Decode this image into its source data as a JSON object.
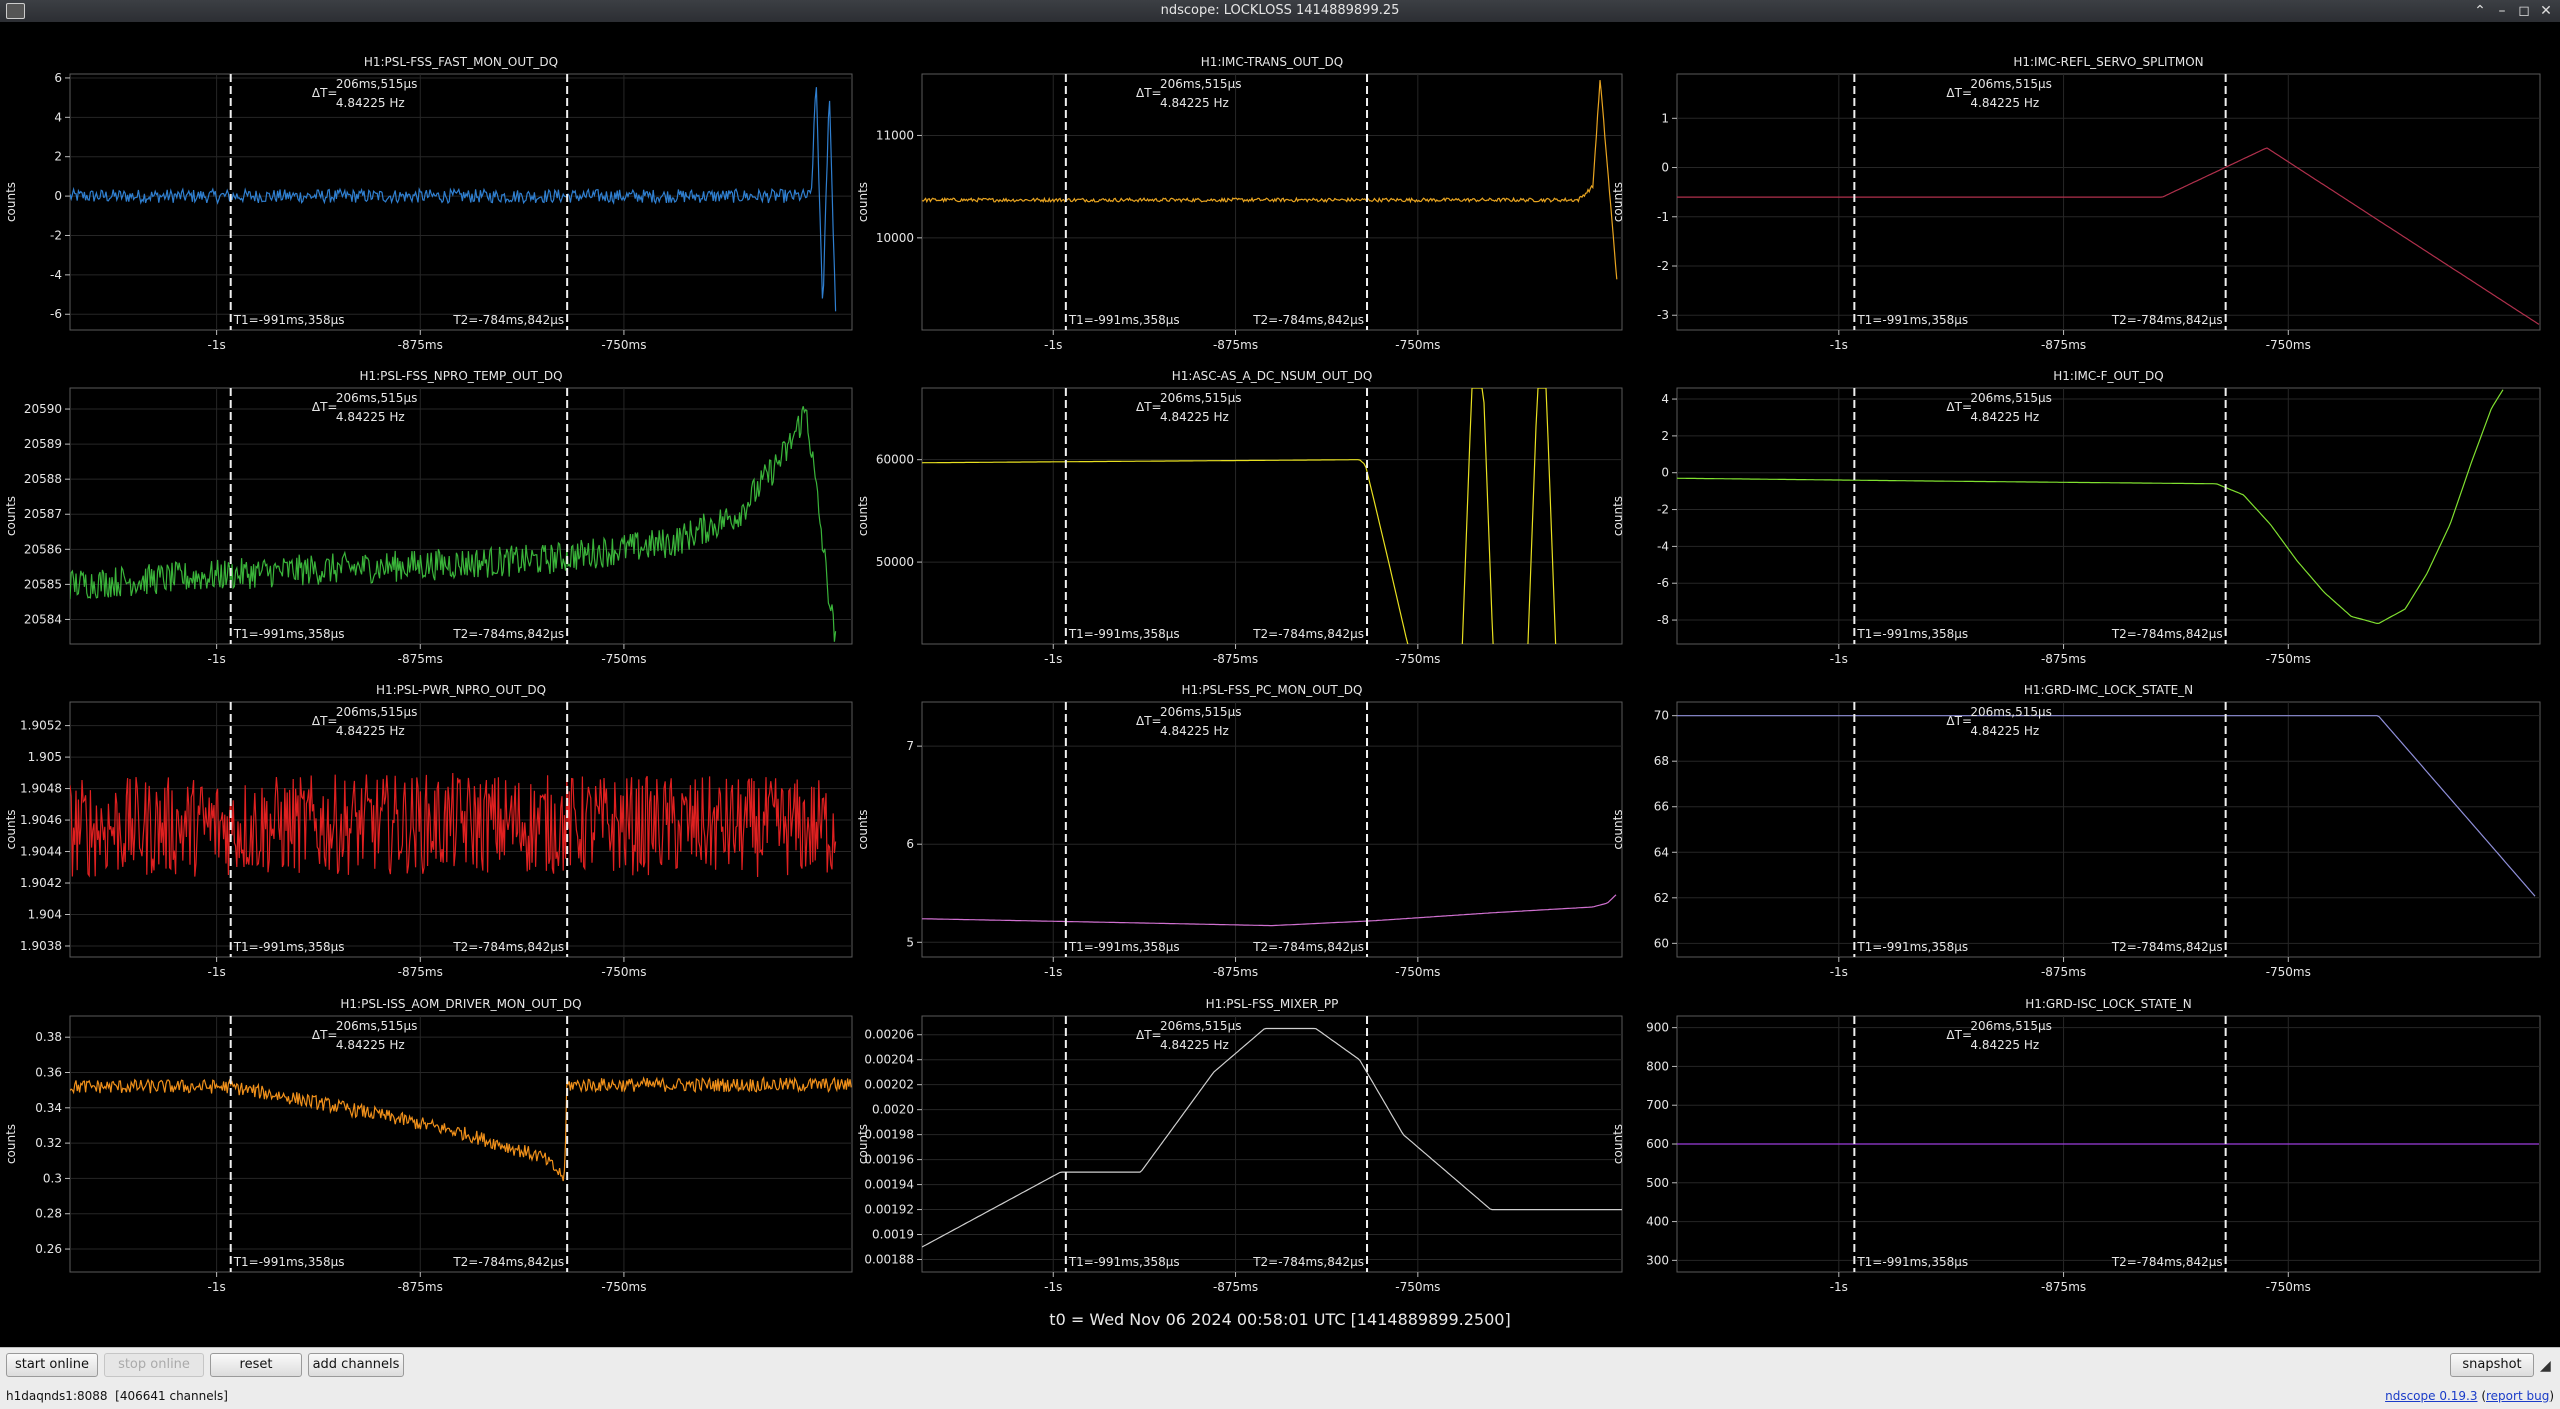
{
  "window": {
    "title": "ndscope: LOCKLOSS 1414889899.25",
    "controls": {
      "shade": "⌃",
      "minimize": "–",
      "maximize": "◻",
      "close": "✕"
    }
  },
  "cursor": {
    "delta_t": "ΔT=",
    "delta_value": "206ms,515μs",
    "freq": "4.84225 Hz",
    "t1_label": "T1=-991ms,358μs",
    "t2_label": "T2=-784ms,842μs",
    "t1_value": -0.991358,
    "t2_value": -0.784842
  },
  "x_axis": {
    "range": [
      -1.09,
      -0.61
    ],
    "ticks": [
      {
        "v": -1.0,
        "label": "-1s"
      },
      {
        "v": -0.875,
        "label": "-875ms"
      },
      {
        "v": -0.75,
        "label": "-750ms"
      }
    ]
  },
  "t0_label": "t0 = Wed Nov 06 2024 00:58:01 UTC [1414889899.2500]",
  "toolbar": {
    "start_online": "start online",
    "stop_online": "stop online",
    "reset": "reset",
    "add_channels": "add channels",
    "snapshot": "snapshot"
  },
  "status": {
    "server": "h1daqnds1:8088",
    "channels": "[406641 channels]",
    "version_link": "ndscope 0.19.3",
    "report_link": "report bug"
  },
  "chart_data": [
    {
      "type": "line",
      "title": "H1:PSL-FSS_FAST_MON_OUT_DQ",
      "ylabel": "counts",
      "color": "#2f7fd0",
      "ylim": [
        -6.8,
        6.2
      ],
      "yticks": [
        {
          "v": 6,
          "label": "6"
        },
        {
          "v": 4,
          "label": "4"
        },
        {
          "v": 2,
          "label": "2"
        },
        {
          "v": 0,
          "label": "0"
        },
        {
          "v": -2,
          "label": "-2"
        },
        {
          "v": -4,
          "label": "-4"
        },
        {
          "v": -6,
          "label": "-6"
        }
      ],
      "x": [
        -1.09,
        -0.95,
        -0.8,
        -0.7,
        -0.635,
        -0.632,
        -0.628,
        -0.624,
        -0.62
      ],
      "y": [
        0.0,
        0.0,
        0.0,
        0.0,
        0.0,
        6.0,
        -6.0,
        5.5,
        -6.0
      ],
      "noise": 0.35
    },
    {
      "type": "line",
      "title": "H1:IMC-TRANS_OUT_DQ",
      "ylabel": "counts",
      "color": "#e8a420",
      "ylim": [
        9100,
        11600
      ],
      "yticks": [
        {
          "v": 11000,
          "label": "11000"
        },
        {
          "v": 10000,
          "label": "10000"
        }
      ],
      "x": [
        -1.09,
        -0.8,
        -0.64,
        -0.63,
        -0.625,
        -0.613
      ],
      "y": [
        10370,
        10370,
        10370,
        10500,
        11550,
        9500
      ],
      "noise": 18
    },
    {
      "type": "line",
      "title": "H1:IMC-REFL_SERVO_SPLITMON",
      "ylabel": "counts",
      "color": "#b0304c",
      "ylim": [
        -3.3,
        1.9
      ],
      "yticks": [
        {
          "v": 1,
          "label": "1"
        },
        {
          "v": 0,
          "label": "0"
        },
        {
          "v": -1,
          "label": "-1"
        },
        {
          "v": -2,
          "label": "-2"
        },
        {
          "v": -3,
          "label": "-3"
        }
      ],
      "x": [
        -1.09,
        -0.82,
        -0.762,
        -0.61
      ],
      "y": [
        -0.6,
        -0.6,
        0.4,
        -3.2
      ],
      "noise": 0
    },
    {
      "type": "line",
      "title": "H1:PSL-FSS_NPRO_TEMP_OUT_DQ",
      "ylabel": "counts",
      "color": "#3ab43a",
      "ylim": [
        20583.3,
        20590.6
      ],
      "yticks": [
        {
          "v": 20590,
          "label": "20590"
        },
        {
          "v": 20589,
          "label": "20589"
        },
        {
          "v": 20588,
          "label": "20588"
        },
        {
          "v": 20587,
          "label": "20587"
        },
        {
          "v": 20586,
          "label": "20586"
        },
        {
          "v": 20585,
          "label": "20585"
        },
        {
          "v": 20584,
          "label": "20584"
        }
      ],
      "x": [
        -1.09,
        -0.95,
        -0.8,
        -0.72,
        -0.68,
        -0.65,
        -0.638,
        -0.625,
        -0.62
      ],
      "y": [
        20585.0,
        20585.4,
        20585.7,
        20586.2,
        20587.0,
        20588.8,
        20590.0,
        20585.0,
        20583.3
      ],
      "noise": 0.45
    },
    {
      "type": "line",
      "title": "H1:ASC-AS_A_DC_NSUM_OUT_DQ",
      "ylabel": "counts",
      "color": "#e8e020",
      "ylim": [
        42000,
        67000
      ],
      "yticks": [
        {
          "v": 60000,
          "label": "60000"
        },
        {
          "v": 50000,
          "label": "50000"
        }
      ],
      "x": [
        -1.09,
        -0.79,
        -0.786,
        -0.78,
        -0.77,
        -0.757,
        -0.75,
        -0.72,
        -0.713,
        -0.705,
        -0.698,
        -0.675,
        -0.668,
        -0.662,
        -0.655
      ],
      "y": [
        59700,
        60000,
        59500,
        56000,
        50000,
        42000,
        40000,
        40000,
        67000,
        67000,
        40000,
        40000,
        67000,
        67000,
        40000
      ],
      "noise": 0
    },
    {
      "type": "line",
      "title": "H1:IMC-F_OUT_DQ",
      "ylabel": "counts",
      "color": "#80e030",
      "ylim": [
        -9.3,
        4.6
      ],
      "yticks": [
        {
          "v": 4,
          "label": "4"
        },
        {
          "v": 2,
          "label": "2"
        },
        {
          "v": 0,
          "label": "0"
        },
        {
          "v": -2,
          "label": "-2"
        },
        {
          "v": -4,
          "label": "-4"
        },
        {
          "v": -6,
          "label": "-6"
        },
        {
          "v": -8,
          "label": "-8"
        }
      ],
      "x": [
        -1.09,
        -0.95,
        -0.79,
        -0.775,
        -0.76,
        -0.745,
        -0.73,
        -0.715,
        -0.7,
        -0.685,
        -0.673,
        -0.66,
        -0.648,
        -0.637,
        -0.63
      ],
      "y": [
        -0.3,
        -0.45,
        -0.6,
        -1.2,
        -2.8,
        -4.8,
        -6.5,
        -7.8,
        -8.2,
        -7.4,
        -5.5,
        -2.8,
        0.6,
        3.5,
        4.6
      ],
      "noise": 0
    },
    {
      "type": "line",
      "title": "H1:PSL-PWR_NPRO_OUT_DQ",
      "ylabel": "counts",
      "color": "#e02020",
      "ylim": [
        1.90373,
        1.90535
      ],
      "yticks": [
        {
          "v": 1.9052,
          "label": "1.9052"
        },
        {
          "v": 1.905,
          "label": "1.905"
        },
        {
          "v": 1.9048,
          "label": "1.9048"
        },
        {
          "v": 1.9046,
          "label": "1.9046"
        },
        {
          "v": 1.9044,
          "label": "1.9044"
        },
        {
          "v": 1.9042,
          "label": "1.9042"
        },
        {
          "v": 1.904,
          "label": "1.904"
        },
        {
          "v": 1.9038,
          "label": "1.9038"
        }
      ],
      "x": [
        -1.09,
        -0.85,
        -0.62
      ],
      "y": [
        1.90455,
        1.90458,
        1.90455
      ],
      "noise": 0.00032
    },
    {
      "type": "line",
      "title": "H1:PSL-FSS_PC_MON_OUT_DQ",
      "ylabel": "counts",
      "color": "#d070d0",
      "ylim": [
        4.85,
        7.45
      ],
      "yticks": [
        {
          "v": 7,
          "label": "7"
        },
        {
          "v": 6,
          "label": "6"
        },
        {
          "v": 5,
          "label": "5"
        }
      ],
      "x": [
        -1.09,
        -0.95,
        -0.85,
        -0.78,
        -0.7,
        -0.63,
        -0.62,
        -0.613
      ],
      "y": [
        5.24,
        5.2,
        5.17,
        5.22,
        5.3,
        5.36,
        5.4,
        5.5
      ],
      "noise": 0
    },
    {
      "type": "line",
      "title": "H1:GRD-IMC_LOCK_STATE_N",
      "ylabel": "counts",
      "color": "#8e8ed8",
      "ylim": [
        59.4,
        70.6
      ],
      "yticks": [
        {
          "v": 70,
          "label": "70"
        },
        {
          "v": 68,
          "label": "68"
        },
        {
          "v": 66,
          "label": "66"
        },
        {
          "v": 64,
          "label": "64"
        },
        {
          "v": 62,
          "label": "62"
        },
        {
          "v": 60,
          "label": "60"
        }
      ],
      "x": [
        -1.09,
        -0.7,
        -0.612
      ],
      "y": [
        70,
        70,
        62
      ],
      "noise": 0
    },
    {
      "type": "line",
      "title": "H1:PSL-ISS_AOM_DRIVER_MON_OUT_DQ",
      "ylabel": "counts",
      "color": "#f0901a",
      "ylim": [
        0.247,
        0.392
      ],
      "yticks": [
        {
          "v": 0.38,
          "label": "0.38"
        },
        {
          "v": 0.36,
          "label": "0.36"
        },
        {
          "v": 0.34,
          "label": "0.34"
        },
        {
          "v": 0.32,
          "label": "0.32"
        },
        {
          "v": 0.3,
          "label": "0.3"
        },
        {
          "v": 0.28,
          "label": "0.28"
        },
        {
          "v": 0.26,
          "label": "0.26"
        }
      ],
      "x": [
        -1.09,
        -0.992,
        -0.95,
        -0.9,
        -0.85,
        -0.8,
        -0.786,
        -0.7855,
        -0.61
      ],
      "y": [
        0.352,
        0.352,
        0.345,
        0.336,
        0.326,
        0.312,
        0.3,
        0.353,
        0.353
      ],
      "noise": 0.004
    },
    {
      "type": "line",
      "title": "H1:PSL-FSS_MIXER_PP",
      "ylabel": "counts",
      "color": "#cfcfcf",
      "ylim": [
        0.00187,
        0.002075
      ],
      "yticks": [
        {
          "v": 0.00206,
          "label": "0.00206"
        },
        {
          "v": 0.00204,
          "label": "0.00204"
        },
        {
          "v": 0.00202,
          "label": "0.00202"
        },
        {
          "v": 0.002,
          "label": "0.0020"
        },
        {
          "v": 0.00198,
          "label": "0.00198"
        },
        {
          "v": 0.00196,
          "label": "0.00196"
        },
        {
          "v": 0.00194,
          "label": "0.00194"
        },
        {
          "v": 0.00192,
          "label": "0.00192"
        },
        {
          "v": 0.0019,
          "label": "0.0019"
        },
        {
          "v": 0.00188,
          "label": "0.00188"
        }
      ],
      "x": [
        -1.09,
        -0.995,
        -0.94,
        -0.89,
        -0.855,
        -0.82,
        -0.79,
        -0.76,
        -0.7,
        -0.61
      ],
      "y": [
        0.00189,
        0.00195,
        0.00195,
        0.00203,
        0.002065,
        0.002065,
        0.00204,
        0.00198,
        0.00192,
        0.00192
      ],
      "noise": 0
    },
    {
      "type": "line",
      "title": "H1:GRD-ISC_LOCK_STATE_N",
      "ylabel": "counts",
      "color": "#9b3cdc",
      "ylim": [
        270,
        930
      ],
      "yticks": [
        {
          "v": 900,
          "label": "900"
        },
        {
          "v": 800,
          "label": "800"
        },
        {
          "v": 700,
          "label": "700"
        },
        {
          "v": 600,
          "label": "600"
        },
        {
          "v": 500,
          "label": "500"
        },
        {
          "v": 400,
          "label": "400"
        },
        {
          "v": 300,
          "label": "300"
        }
      ],
      "x": [
        -1.09,
        -0.61
      ],
      "y": [
        600,
        600
      ],
      "noise": 0
    }
  ]
}
